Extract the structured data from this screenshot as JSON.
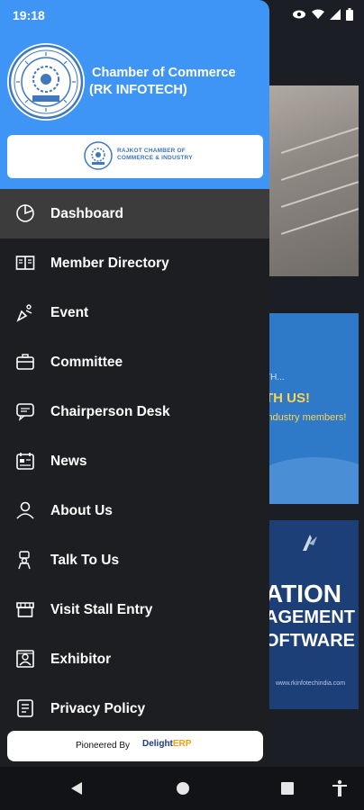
{
  "status_bar": {
    "time": "19:18"
  },
  "drawer": {
    "header": {
      "title_line1": "Chamber of Commerce",
      "title_line2": "(RK INFOTECH)",
      "banner_line1": "RAJKOT CHAMBER OF",
      "banner_line2": "COMMERCE & INDUSTRY"
    },
    "menu": [
      {
        "label": "Dashboard",
        "icon": "dashboard-icon"
      },
      {
        "label": "Member Directory",
        "icon": "book-icon"
      },
      {
        "label": "Event",
        "icon": "event-icon"
      },
      {
        "label": "Committee",
        "icon": "briefcase-icon"
      },
      {
        "label": "Chairperson Desk",
        "icon": "chat-icon"
      },
      {
        "label": "News",
        "icon": "news-icon"
      },
      {
        "label": "About Us",
        "icon": "user-icon"
      },
      {
        "label": "Talk To Us",
        "icon": "talk-icon"
      },
      {
        "label": "Visit Stall Entry",
        "icon": "stall-icon"
      },
      {
        "label": "Exhibitor",
        "icon": "exhibitor-icon"
      },
      {
        "label": "Privacy Policy",
        "icon": "document-icon"
      }
    ],
    "footer": {
      "prefix": "Pioneered By",
      "brand_a": "Delight",
      "brand_b": "ERP"
    }
  },
  "background": {
    "card2_small": "TH...",
    "card2_big": "TH US!",
    "card2_sub": "industry members!",
    "card3_line1": "ATION",
    "card3_line2": "AGEMENT",
    "card3_line3": "OFTWARE",
    "card3_footer": "www.rkinfotechindia.com"
  },
  "colors": {
    "header_blue": "#3f95f5",
    "drawer_bg": "#1d1e21",
    "active_row": "#3d3c3c"
  }
}
